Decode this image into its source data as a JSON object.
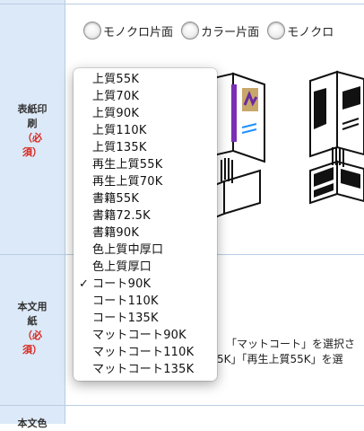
{
  "rows": [
    {
      "label_lines": [
        "表紙印",
        "刷"
      ],
      "required": [
        "（必",
        "須）"
      ]
    },
    {
      "label_lines": [
        "本文用",
        "紙"
      ],
      "required": [
        "（必",
        "須）"
      ]
    },
    {
      "label_lines": [
        "本文色"
      ]
    }
  ],
  "print_options": [
    "モノクロ片面",
    "カラー片面",
    "モノクロ"
  ],
  "description_lines": [
    "「マットコート」を選択さ",
    "5K」「再生上質55K」を選"
  ],
  "dropdown": {
    "items": [
      {
        "label": "上質55K",
        "checked": false
      },
      {
        "label": "上質70K",
        "checked": false
      },
      {
        "label": "上質90K",
        "checked": false
      },
      {
        "label": "上質110K",
        "checked": false
      },
      {
        "label": "上質135K",
        "checked": false
      },
      {
        "label": "再生上質55K",
        "checked": false
      },
      {
        "label": "再生上質70K",
        "checked": false
      },
      {
        "label": "書籍55K",
        "checked": false
      },
      {
        "label": "書籍72.5K",
        "checked": false
      },
      {
        "label": "書籍90K",
        "checked": false
      },
      {
        "label": "色上質中厚口",
        "checked": false
      },
      {
        "label": "色上質厚口",
        "checked": false
      },
      {
        "label": "コート90K",
        "checked": true
      },
      {
        "label": "コート110K",
        "checked": false
      },
      {
        "label": "コート135K",
        "checked": false
      },
      {
        "label": "マットコート90K",
        "checked": false
      },
      {
        "label": "マットコート110K",
        "checked": false
      },
      {
        "label": "マットコート135K",
        "checked": false
      }
    ],
    "check_mark": "✓"
  },
  "colors": {
    "label_bg": "#dce9f8",
    "border": "#b9cde3",
    "required": "#d9241b"
  },
  "icons": [
    "book-binding-illustration-color",
    "book-binding-illustration-mono"
  ]
}
